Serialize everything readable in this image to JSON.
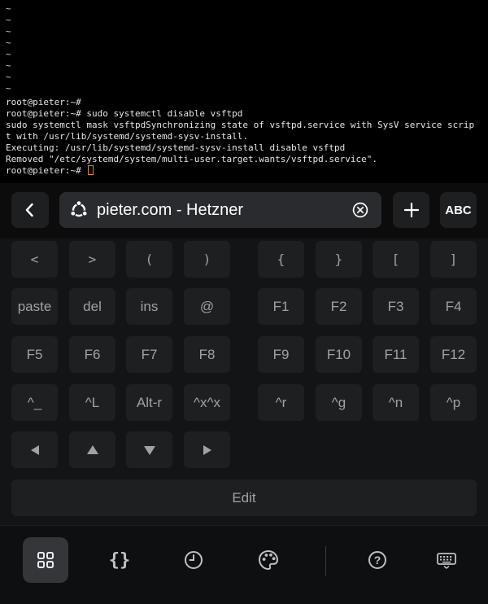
{
  "terminal": {
    "tildes": [
      "~",
      "~",
      "~",
      "~",
      "~",
      "~",
      "~",
      "~"
    ],
    "lines": [
      "root@pieter:~#",
      "root@pieter:~# sudo systemctl disable vsftpd",
      "sudo systemctl mask vsftpdSynchronizing state of vsftpd.service with SysV service scrip",
      "t with /usr/lib/systemd/systemd-sysv-install.",
      "Executing: /usr/lib/systemd/systemd-sysv-install disable vsftpd",
      "Removed \"/etc/systemd/system/multi-user.target.wants/vsftpd.service\"."
    ],
    "prompt": "root@pieter:~#"
  },
  "topbar": {
    "back_icon": "chevron-left-icon",
    "session_title": "pieter.com - Hetzner",
    "session_icon": "ubuntu-icon",
    "clear_icon": "close-circle-icon",
    "add_icon": "plus-icon",
    "abc_label": "ABC"
  },
  "keys": {
    "row1": [
      "<",
      ">",
      "(",
      ")",
      "{",
      "}",
      "[",
      "]"
    ],
    "row2": [
      "paste",
      "del",
      "ins",
      "@",
      "F1",
      "F2",
      "F3",
      "F4"
    ],
    "row3": [
      "F5",
      "F6",
      "F7",
      "F8",
      "F9",
      "F10",
      "F11",
      "F12"
    ],
    "row4": [
      "^_",
      "^L",
      "Alt-r",
      "^x^x",
      "^r",
      "^g",
      "^n",
      "^p"
    ],
    "arrows": [
      "left-arrow-icon",
      "up-arrow-icon",
      "down-arrow-icon",
      "right-arrow-icon"
    ],
    "edit_label": "Edit"
  },
  "bottombar": {
    "icons": [
      "grid-icon",
      "braces-icon",
      "history-icon",
      "palette-icon",
      "help-icon",
      "keyboard-icon"
    ],
    "braces_text": "{}",
    "help_text": "?"
  },
  "colors": {
    "cursor": "#d98a2a",
    "key_bg": "#1e1f21",
    "active_tab_bg": "#34363a"
  }
}
